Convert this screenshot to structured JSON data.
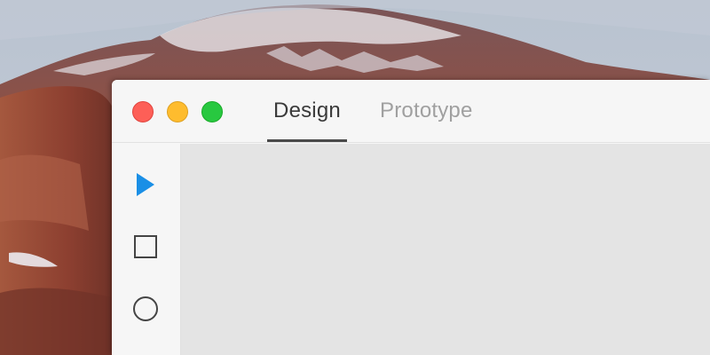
{
  "window": {
    "controls": {
      "close_color": "#fd5f57",
      "minimize_color": "#febc2e",
      "zoom_color": "#28c840"
    },
    "tabs": [
      {
        "label": "Design",
        "active": true
      },
      {
        "label": "Prototype",
        "active": false
      }
    ]
  },
  "toolbar": {
    "tools": [
      {
        "name": "select",
        "icon": "arrow-pointer-icon",
        "color": "#1a8fe6",
        "selected": true
      },
      {
        "name": "rectangle",
        "icon": "rectangle-icon",
        "color": "#444444",
        "selected": false
      },
      {
        "name": "ellipse",
        "icon": "ellipse-icon",
        "color": "#444444",
        "selected": false
      }
    ]
  },
  "colors": {
    "canvas": "#e4e4e4",
    "chrome": "#f6f6f6",
    "accent": "#1a8fe6"
  }
}
